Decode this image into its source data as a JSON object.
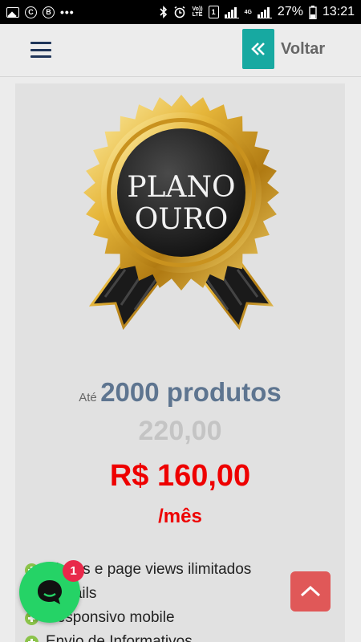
{
  "status_bar": {
    "icons_left": [
      "image-icon",
      "copyright-icon",
      "b-icon",
      "more-dots-icon"
    ],
    "copyright_glyph": "C",
    "b_glyph": "B",
    "dots": "•••",
    "volte_top": "Vo))",
    "volte_bottom": "LTE",
    "sim": "1",
    "net_4g": "4G",
    "battery": "27%",
    "time": "13:21"
  },
  "header": {
    "back_label": "Voltar"
  },
  "plan": {
    "badge_line1": "PLANO",
    "badge_line2": "OURO",
    "limit_prefix": "Até",
    "limit_value": "2000 produtos",
    "old_price": "220,00",
    "new_price": "R$ 160,00",
    "period": "/mês",
    "features": [
      "Visitas e page views ilimitados",
      "E-mails",
      "Responsivo mobile",
      "Envio de Informativos"
    ]
  },
  "chat": {
    "badge_count": "1"
  },
  "colors": {
    "accent_teal": "#17a9a1",
    "price_red": "#ee0000",
    "muted_blue": "#5e7590",
    "whatsapp_green": "#25d366",
    "scroll_red": "#e05858"
  }
}
